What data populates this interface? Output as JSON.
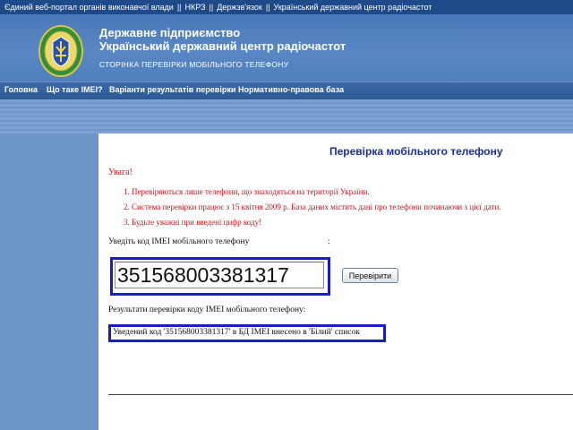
{
  "top_links": [
    "Єдиний веб-портал органів виконавчої влади",
    "НКРЗ",
    "Держзв'язок",
    "Український державний центр радіочастот"
  ],
  "top_separator": "||",
  "header": {
    "org_line1": "Державне підприємство",
    "org_line2": "Український державний центр радіочастот",
    "subtitle": "СТОРІНКА ПЕРЕВІРКИ МОБІЛЬНОГО ТЕЛЕФОНУ"
  },
  "nav": [
    "Головна",
    "Що таке IMEI?",
    "Варіанти результатів перевірки",
    "Нормативно-правова база"
  ],
  "page_title": "Перевірка мобільного телефону",
  "warning": {
    "heading": "Увага!",
    "items": [
      "1.  Перевіряються лише телефони, що знаходяться на території України.",
      "2.  Система перевірки працює з 15 квітня 2009 р. База даних містить дані про телефони починаючи з цієї дати.",
      "3.  Будьте уважні при введені цифр коду!"
    ]
  },
  "form": {
    "imei_label": "Уведіть код IMEI мобільного телефону",
    "colon": ":",
    "imei_value": "351568003381317",
    "check_button": "Перевірити"
  },
  "result": {
    "label": "Результати перевірки коду IMEI мобільного телефону:",
    "text": "Уведений код '351568003381317' в БД IMEI внесено в 'Білий' список"
  },
  "colors": {
    "top_bar": "#1f4a8a",
    "banner": "#5987c4",
    "warning_red": "#c4161c",
    "title_blue": "#1a2f9c",
    "highlight_border": "#1a1ec2"
  }
}
